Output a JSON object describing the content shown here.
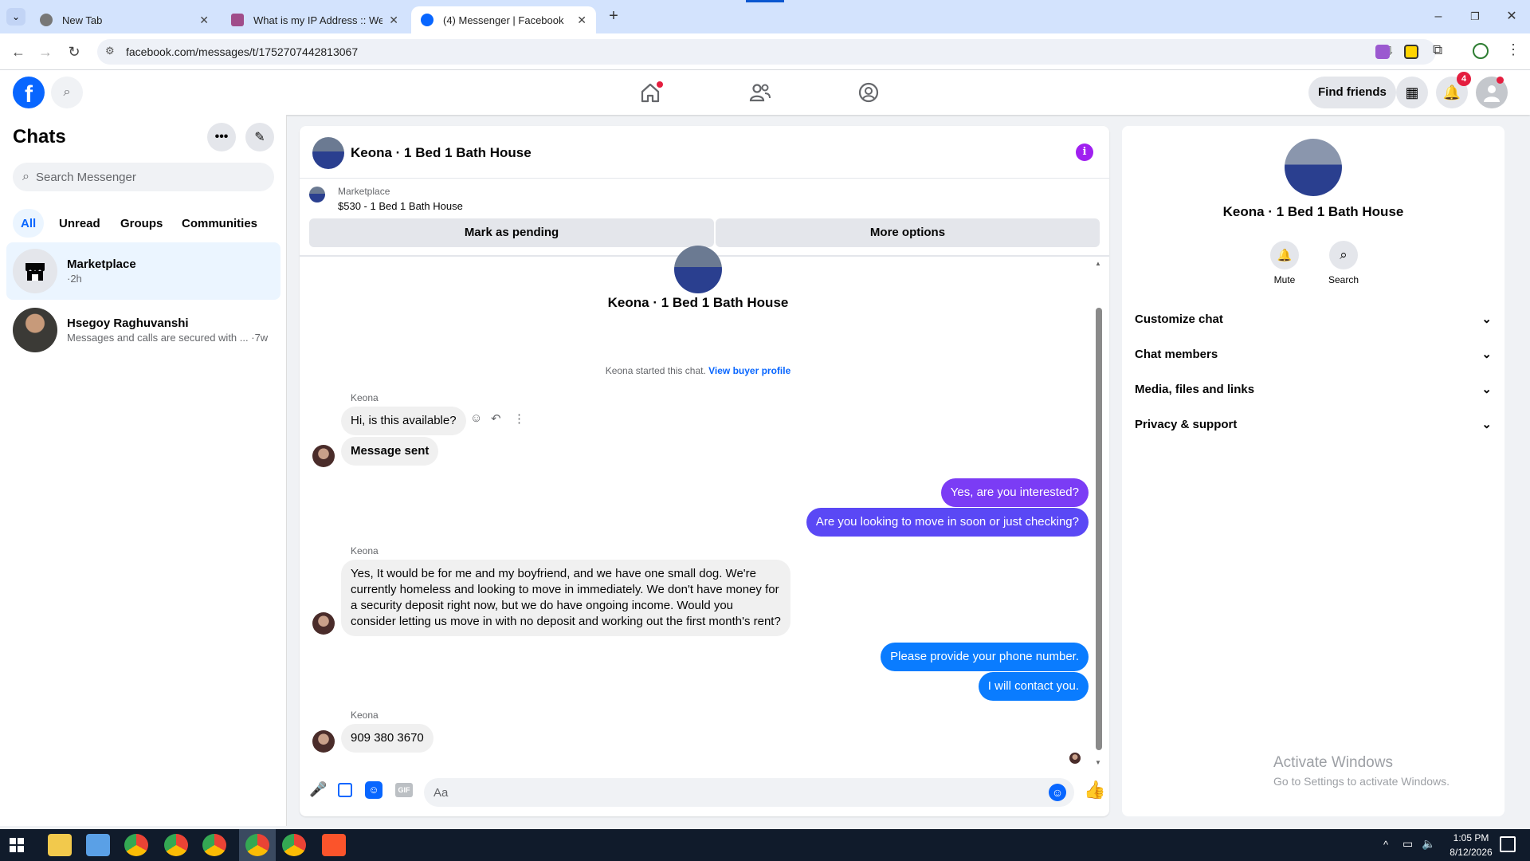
{
  "browser": {
    "tabs": [
      {
        "title": "New Tab",
        "active": false
      },
      {
        "title": "What is my IP Address :: WebBr",
        "active": false
      },
      {
        "title": "(4) Messenger | Facebook",
        "active": true
      }
    ],
    "url": "facebook.com/messages/t/1752707442813067"
  },
  "fb_header": {
    "find_friends": "Find friends",
    "notifications_count": "4"
  },
  "sidebar": {
    "title": "Chats",
    "search_placeholder": "Search Messenger",
    "filters": [
      "All",
      "Unread",
      "Groups",
      "Communities"
    ],
    "chats": [
      {
        "name": "Marketplace",
        "preview": "·2h",
        "selected": true
      },
      {
        "name": "Hsegoy Raghuvanshi",
        "preview": "Messages and calls are secured with ...",
        "time": "·7w",
        "selected": false
      }
    ]
  },
  "conversation": {
    "title": "Keona · 1 Bed 1 Bath House",
    "listing": {
      "source": "Marketplace",
      "item": "$530 - 1 Bed 1 Bath House"
    },
    "mark_pending": "Mark as pending",
    "more_options": "More options",
    "intro_name": "Keona · 1 Bed 1 Bath House",
    "started_text": "Keona started this chat.",
    "buyer_profile_link": "View buyer profile",
    "sender_name": "Keona",
    "messages": {
      "m1": "Hi, is this available?",
      "m2": "Message sent",
      "m3": "Yes, are you interested?",
      "m4": "Are you looking to move in soon or just checking?",
      "m5": "Yes, It would be for me and my boyfriend, and we have one small dog. We're currently homeless and looking to move in immediately. We don't have money for a security deposit right now, but we do have ongoing income. Would you consider letting us move in with no deposit and working out the first month's rent?",
      "m6": "Please provide your phone number.",
      "m7": "I will contact you.",
      "m8": "909 380 3670"
    },
    "composer_placeholder": "Aa"
  },
  "details": {
    "name": "Keona · 1 Bed 1 Bath House",
    "mute": "Mute",
    "search": "Search",
    "sections": [
      "Customize chat",
      "Chat members",
      "Media, files and links",
      "Privacy & support"
    ]
  },
  "watermark": {
    "line1": "Activate Windows",
    "line2": "Go to Settings to activate Windows."
  },
  "taskbar": {
    "time": "1:05 PM",
    "date": "8/12/2026"
  },
  "colors": {
    "fb_blue": "#0866ff",
    "outgoing_blue": "#0a7cff",
    "outgoing_purple": "#7b3cf5",
    "notification_red": "#e41e3f"
  }
}
